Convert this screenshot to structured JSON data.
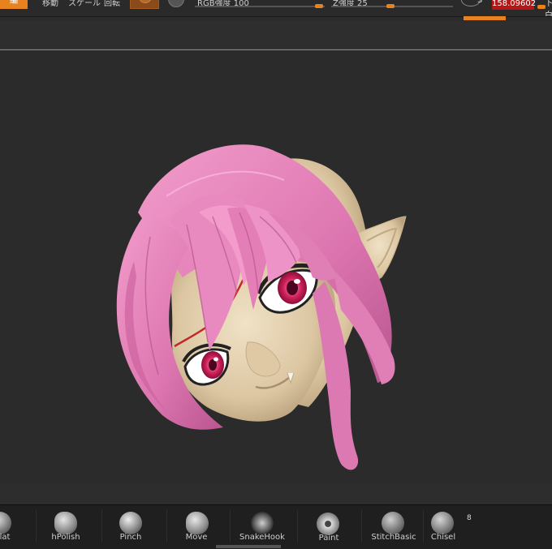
{
  "toolbar": {
    "edit_label": "編",
    "move_label": "移動",
    "scale_label": "スケール",
    "rotate_label": "回転",
    "rgb_intensity": "RGB強度 100",
    "z_intensity": "Z強度 25",
    "s_label": "S",
    "focal_value": "158.09602",
    "suffix": "下白"
  },
  "brushes": [
    {
      "label": "lat",
      "icon": "flat-brush-icon"
    },
    {
      "label": "hPolish",
      "icon": "hpolish-brush-icon"
    },
    {
      "label": "Pinch",
      "icon": "pinch-brush-icon"
    },
    {
      "label": "Move",
      "icon": "move-brush-icon"
    },
    {
      "label": "SnakeHook",
      "icon": "snakehook-brush-icon"
    },
    {
      "label": "Paint",
      "icon": "paint-brush-icon"
    },
    {
      "label": "StitchBasic",
      "icon": "stitchbasic-brush-icon"
    },
    {
      "label": "Chisel",
      "icon": "chisel-brush-icon"
    }
  ],
  "brush_count": "8",
  "colors": {
    "accent": "#e8821e",
    "value_red": "#b51616",
    "hair": "#e27db5",
    "skin": "#e6d3b3",
    "eye": "#c0184f"
  }
}
